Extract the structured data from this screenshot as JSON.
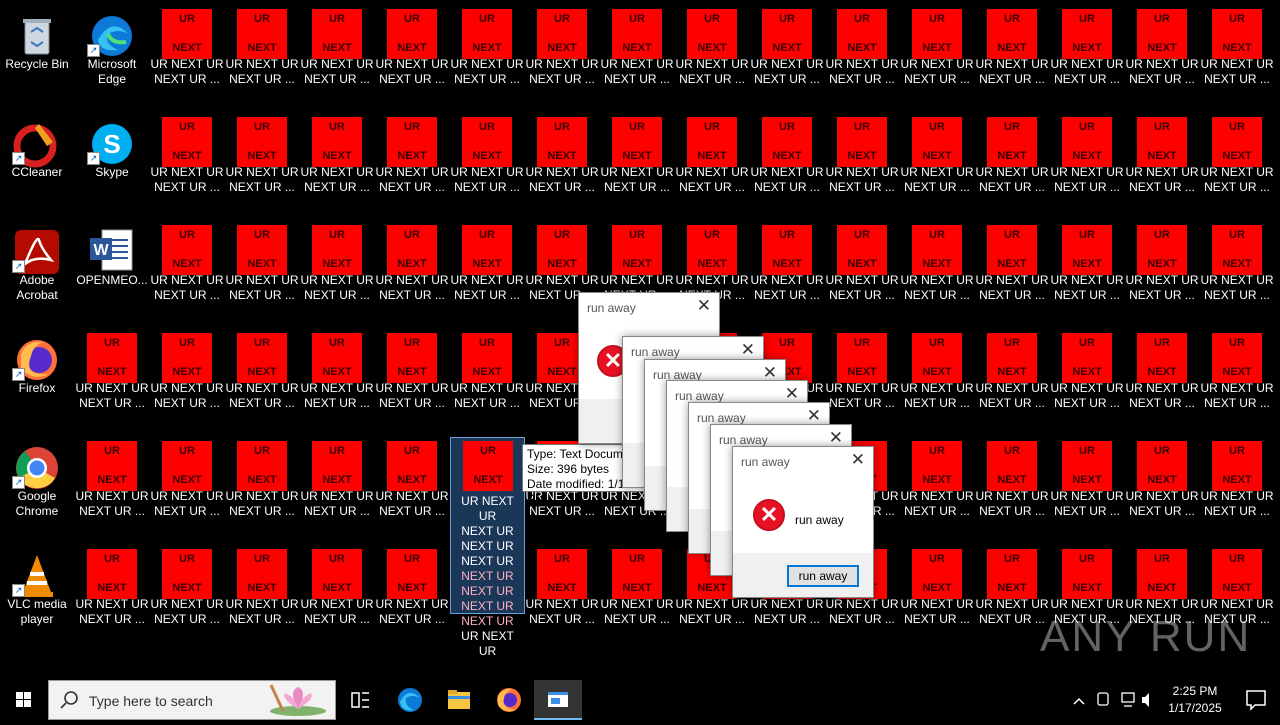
{
  "desktop": {
    "left_icons": [
      {
        "label": "Recycle Bin",
        "icon": "recycle-bin-icon"
      },
      {
        "label": "Microsoft Edge",
        "icon": "edge-icon"
      },
      {
        "label": "CCleaner",
        "icon": "ccleaner-icon"
      },
      {
        "label": "Skype",
        "icon": "skype-icon"
      },
      {
        "label": "Adobe Acrobat",
        "icon": "acrobat-icon"
      },
      {
        "label": "OPENMEO...",
        "icon": "word-document-icon"
      },
      {
        "label": "Firefox",
        "icon": "firefox-icon"
      },
      {
        "label": "Google Chrome",
        "icon": "chrome-icon"
      },
      {
        "label": "VLC media player",
        "icon": "vlc-icon"
      }
    ],
    "red_file": {
      "top_text": "UR",
      "bottom_text": "NEXT",
      "label_line1": "UR NEXT UR",
      "label_line2": "NEXT UR ..."
    },
    "selected_file_lines": [
      "UR NEXT UR",
      "NEXT UR",
      "NEXT UR",
      "NEXT UR",
      "NEXT UR",
      "NEXT UR",
      "NEXT UR",
      "NEXT UR",
      "UR NEXT UR"
    ],
    "tooltip": {
      "type": "Type: Text Document",
      "size": "Size: 396 bytes",
      "modified": "Date modified: 1/17/2025 2:23 PM"
    }
  },
  "dialogs": {
    "title": "run away",
    "message": "run away",
    "button": "run away",
    "close_glyph": "✕",
    "error_glyph": "✕"
  },
  "watermark": "ANY RUN",
  "taskbar": {
    "search_placeholder": "Type here to search",
    "time": "2:25 PM",
    "date": "1/17/2025"
  },
  "colors": {
    "red_file": "#ff0000",
    "error": "#e81123",
    "accent": "#0078d7"
  }
}
